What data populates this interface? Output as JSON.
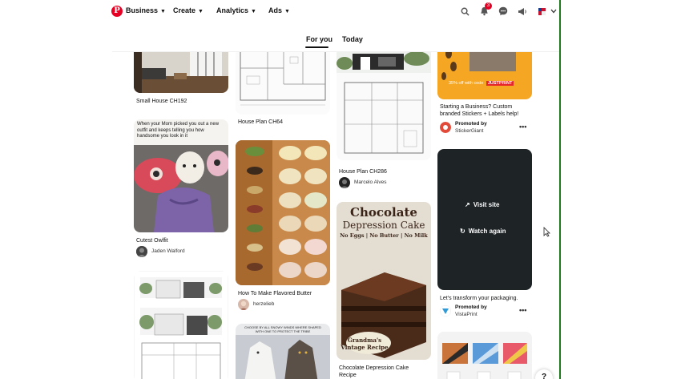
{
  "header": {
    "logo": "P",
    "nav": [
      {
        "label": "Business"
      },
      {
        "label": "Create"
      },
      {
        "label": "Analytics"
      },
      {
        "label": "Ads"
      }
    ],
    "notification_count": "3"
  },
  "tabs": [
    {
      "label": "For you",
      "active": true
    },
    {
      "label": "Today",
      "active": false
    }
  ],
  "pins": {
    "small_house": {
      "title": "Small House CH192"
    },
    "cutest_owlfit": {
      "title": "Cutest Owlfit",
      "author": "Jaden Walford",
      "caption": "When your Mom picked you out a new outfit and keeps telling you how handsome you look in it"
    },
    "house_plan_64": {
      "title": "House Plan CH64"
    },
    "flavored_butter": {
      "title": "How To Make Flavored Butter",
      "author": "herzelieb"
    },
    "wolf_caption": "CHOOSE BY ALL SNOWY WINDS WHERE SHAPED WITH ONE TO PROTECT THE TRIBE",
    "house_plan_286": {
      "title": "House Plan CH286",
      "author": "Marcelo Alves"
    },
    "chocolate_cake": {
      "title_line1": "Chocolate Depression Cake",
      "title_line2": "Recipe",
      "img_title_1": "Chocolate",
      "img_title_2": "Depression Cake",
      "img_sub": "No Eggs | No Butter | No Milk",
      "img_badge_1": "Grandma's",
      "img_badge_2": "Vintage Recipe"
    },
    "stickers": {
      "title_line1": "Starting a Business? Custom",
      "title_line2": "branded Stickers + Labels help!",
      "promoted": "Promoted by",
      "advertiser": "StickerGiant",
      "img_text": "35% off with code",
      "img_code": "JUSTPRINT"
    },
    "vistaprint": {
      "title": "Let's transform your packaging.",
      "promoted": "Promoted by",
      "advertiser": "VistaPrint",
      "visit_site": "Visit site",
      "watch_again": "Watch again"
    }
  },
  "more_icon": "•••",
  "help_label": "?",
  "colors": {
    "brand": "#e60023",
    "accent_edge": "#1f7a1f"
  }
}
